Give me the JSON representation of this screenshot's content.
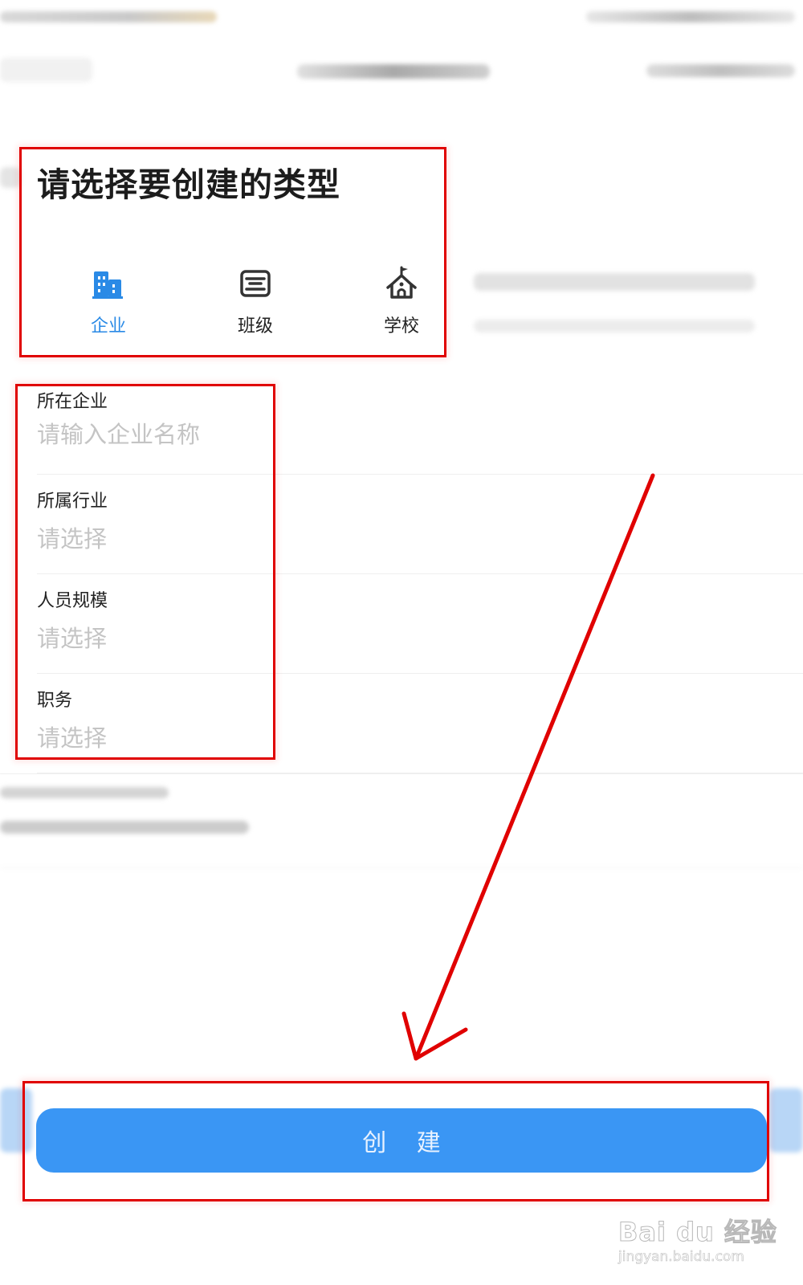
{
  "create_type": {
    "title": "请选择要创建的类型",
    "options": [
      {
        "label": "企业",
        "icon": "building-icon",
        "selected": true
      },
      {
        "label": "班级",
        "icon": "class-board-icon",
        "selected": false
      },
      {
        "label": "学校",
        "icon": "school-icon",
        "selected": false
      }
    ]
  },
  "form": {
    "fields": [
      {
        "label": "所在企业",
        "placeholder": "请输入企业名称"
      },
      {
        "label": "所属行业",
        "placeholder": "请选择"
      },
      {
        "label": "人员规模",
        "placeholder": "请选择"
      },
      {
        "label": "职务",
        "placeholder": "请选择"
      }
    ]
  },
  "actions": {
    "create_label": "创 建"
  },
  "watermark": {
    "brand": "Bai du 经验",
    "url": "jingyan.baidu.com"
  },
  "colors": {
    "accent": "#2a8ae6",
    "button": "#3a96f4",
    "annotation": "#e00000",
    "placeholder": "#c4c4c4"
  }
}
